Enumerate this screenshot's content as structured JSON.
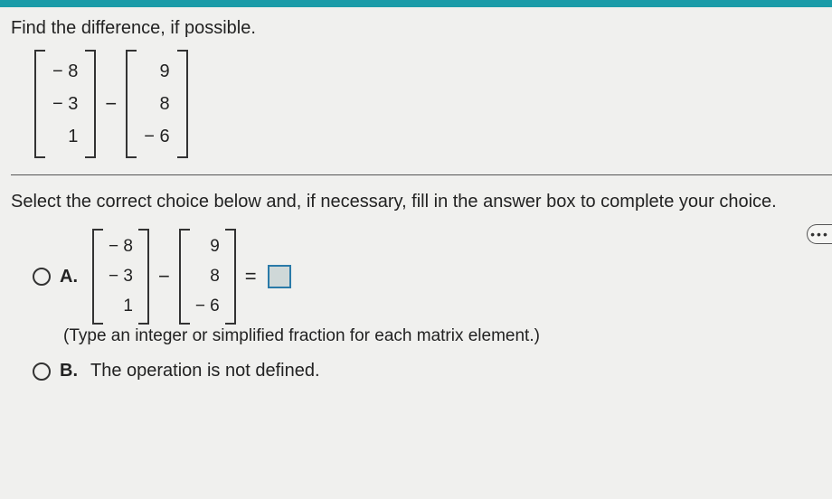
{
  "question": "Find the difference, if possible.",
  "matrixA": [
    "− 8",
    "− 3",
    "1"
  ],
  "matrixB": [
    "9",
    "8",
    "− 6"
  ],
  "opMinus": "−",
  "opEquals": "=",
  "instruction": "Select the correct choice below and, if necessary, fill in the answer box to complete your choice.",
  "choiceA": {
    "label": "A.",
    "hint": "(Type an integer or simplified fraction for each matrix element.)"
  },
  "choiceB": {
    "label": "B.",
    "text": "The operation is not defined."
  },
  "dots": "•••"
}
